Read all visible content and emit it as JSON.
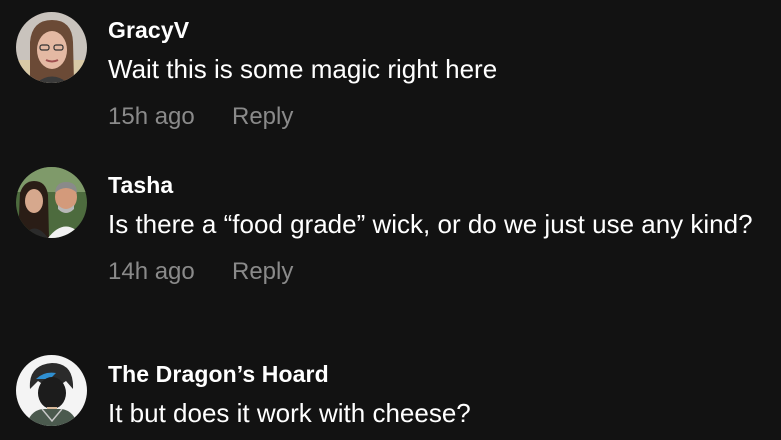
{
  "comments": [
    {
      "username": "GracyV",
      "text": "Wait this is some magic right here",
      "time": "15h ago",
      "reply_label": "Reply"
    },
    {
      "username": "Tasha",
      "text": "Is there a “food grade” wick, or do we just use any kind?",
      "time": "14h ago",
      "reply_label": "Reply"
    },
    {
      "username": "The Dragon’s Hoard",
      "text": "It but does it work with cheese?"
    }
  ]
}
